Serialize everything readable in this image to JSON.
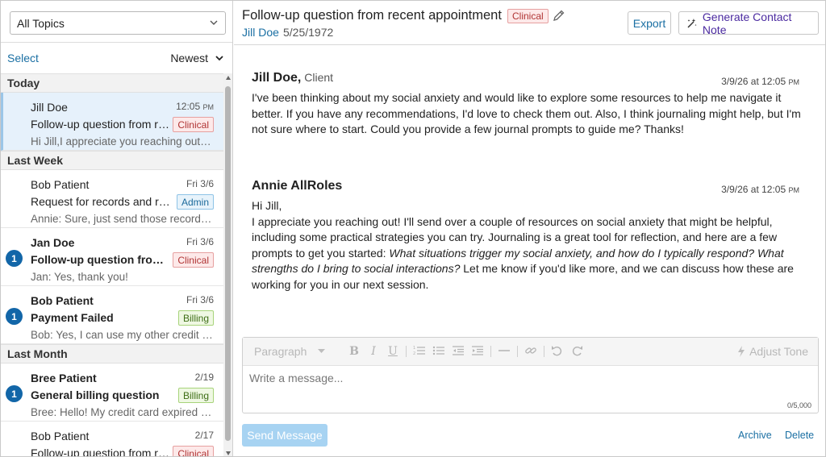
{
  "sidebar": {
    "topic_filter": "All Topics",
    "select_label": "Select",
    "sort_label": "Newest",
    "groups": [
      {
        "label": "Today",
        "threads": [
          {
            "name": "Jill Doe",
            "date": "12:05",
            "date_suffix": "PM",
            "subject": "Follow-up question from recent appointment",
            "badge": "Clinical",
            "badge_type": "clinical",
            "preview": "Hi Jill,I appreciate you reaching out! I'll send over a couple of resources",
            "unread": false,
            "unread_count": "",
            "selected": true
          }
        ]
      },
      {
        "label": "Last Week",
        "threads": [
          {
            "name": "Bob Patient",
            "date": "Fri 3/6",
            "date_suffix": "",
            "subject": "Request for records and receipts",
            "badge": "Admin",
            "badge_type": "admin",
            "preview": "Annie: Sure, just send those records over",
            "unread": false,
            "unread_count": "",
            "selected": false
          },
          {
            "name": "Jan Doe",
            "date": "Fri 3/6",
            "date_suffix": "",
            "subject": "Follow-up question from recent appointment",
            "badge": "Clinical",
            "badge_type": "clinical",
            "preview": "Jan: Yes, thank you!",
            "unread": true,
            "unread_count": "1",
            "selected": false
          },
          {
            "name": "Bob Patient",
            "date": "Fri 3/6",
            "date_suffix": "",
            "subject": "Payment Failed",
            "badge": "Billing",
            "badge_type": "billing",
            "preview": "Bob: Yes, I can use my other credit card",
            "unread": true,
            "unread_count": "1",
            "selected": false
          }
        ]
      },
      {
        "label": "Last Month",
        "threads": [
          {
            "name": "Bree Patient",
            "date": "2/19",
            "date_suffix": "",
            "subject": "General billing question",
            "badge": "Billing",
            "badge_type": "billing",
            "preview": "Bree: Hello! My credit card expired last month",
            "unread": true,
            "unread_count": "1",
            "selected": false
          },
          {
            "name": "Bob Patient",
            "date": "2/17",
            "date_suffix": "",
            "subject": "Follow-up question from recent appointment",
            "badge": "Clinical",
            "badge_type": "clinical",
            "preview": "",
            "unread": false,
            "unread_count": "",
            "selected": false
          }
        ]
      }
    ]
  },
  "conversation": {
    "title": "Follow-up question from recent appointment",
    "badge": "Clinical",
    "client_name": "Jill Doe",
    "client_dob": "5/25/1972",
    "export_label": "Export",
    "note_label": "Generate Contact Note",
    "messages": [
      {
        "author": "Jill Doe,",
        "role": "Client",
        "date": "3/9/26 at 12:05",
        "date_suffix": "PM",
        "paragraphs": [
          "I've been thinking about my social anxiety and would like to explore some resources to help me navigate it better. If you have any recommendations, I'd love to check them out. Also, I think journaling might help, but I'm not sure where to start. Could you provide a few journal prompts to guide me? Thanks!"
        ]
      },
      {
        "author": "Annie AllRoles",
        "role": "",
        "date": "3/9/26 at 12:05",
        "date_suffix": "PM",
        "greeting": "Hi Jill,",
        "body_start": "I appreciate you reaching out! I'll send over a couple of resources on social anxiety that might be helpful, including some practical strategies you can try. Journaling is a great tool for reflection, and here are a few prompts to get you started: ",
        "body_italic": "What situations trigger my social anxiety, and how do I typically respond? What strengths do I bring to social interactions?",
        "body_end": " Let me know if you'd like more, and we can discuss how these are working for you in our next session."
      }
    ]
  },
  "composer": {
    "paragraph_label": "Paragraph",
    "adjust_tone_label": "Adjust Tone",
    "placeholder": "Write a message...",
    "char_count": "0/5,000",
    "send_label": "Send Message",
    "archive_label": "Archive",
    "delete_label": "Delete"
  },
  "colors": {
    "link": "#1a6fa3",
    "accent_dark": "#1266a8",
    "note_button_text": "#4b2aa0",
    "send_button_bg": "#a7d3f2"
  }
}
